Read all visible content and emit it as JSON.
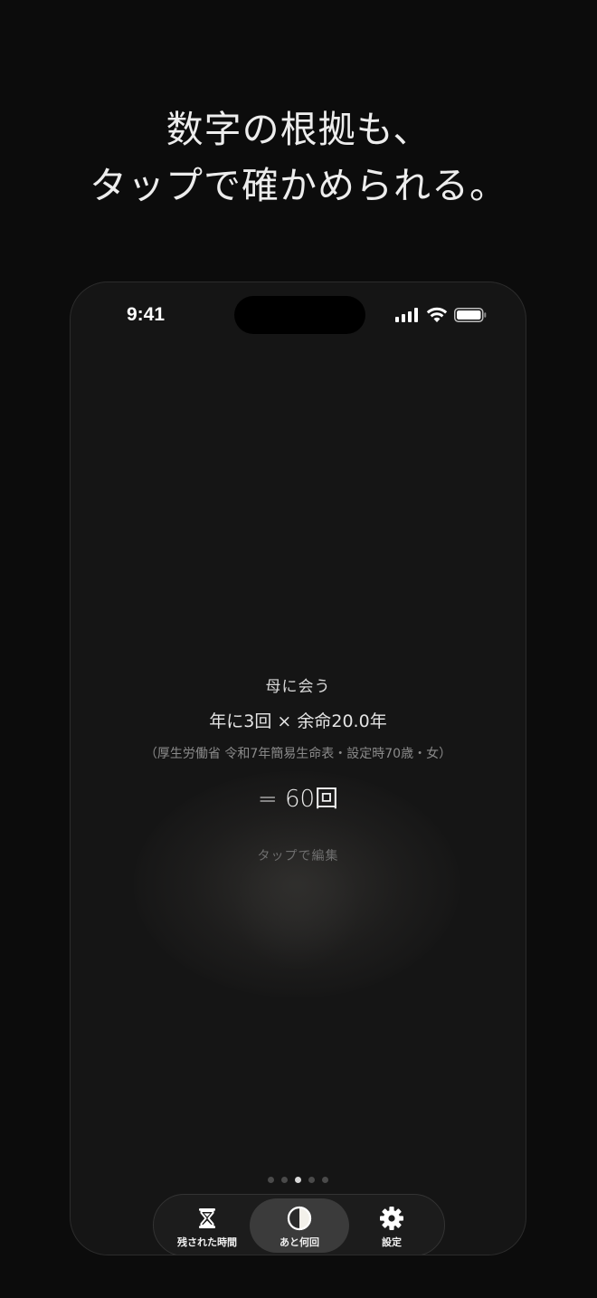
{
  "headline": {
    "line1": "数字の根拠も、",
    "line2": "タップで確かめられる。"
  },
  "status_bar": {
    "time": "9:41",
    "signal_icon": "cellular-signal-icon",
    "wifi_icon": "wifi-icon",
    "battery_icon": "battery-icon"
  },
  "card": {
    "title": "母に会う",
    "formula": "年に3回 × 余命20.0年",
    "source": "（厚生労働省 令和7年簡易生命表・設定時70歳・女）",
    "result": "= 60回",
    "hint": "タップで編集"
  },
  "page_indicator": {
    "count": 5,
    "active_index": 2
  },
  "tabs": [
    {
      "label": "残された時間",
      "icon": "hourglass-icon",
      "active": false
    },
    {
      "label": "あと何回",
      "icon": "half-circle-icon",
      "active": true
    },
    {
      "label": "設定",
      "icon": "gear-icon",
      "active": false
    }
  ],
  "colors": {
    "background": "#0c0c0c",
    "phone_background": "#151515",
    "active_tab": "#3b3b3b",
    "text_primary": "#ededed",
    "text_secondary": "#8a8a8a"
  }
}
